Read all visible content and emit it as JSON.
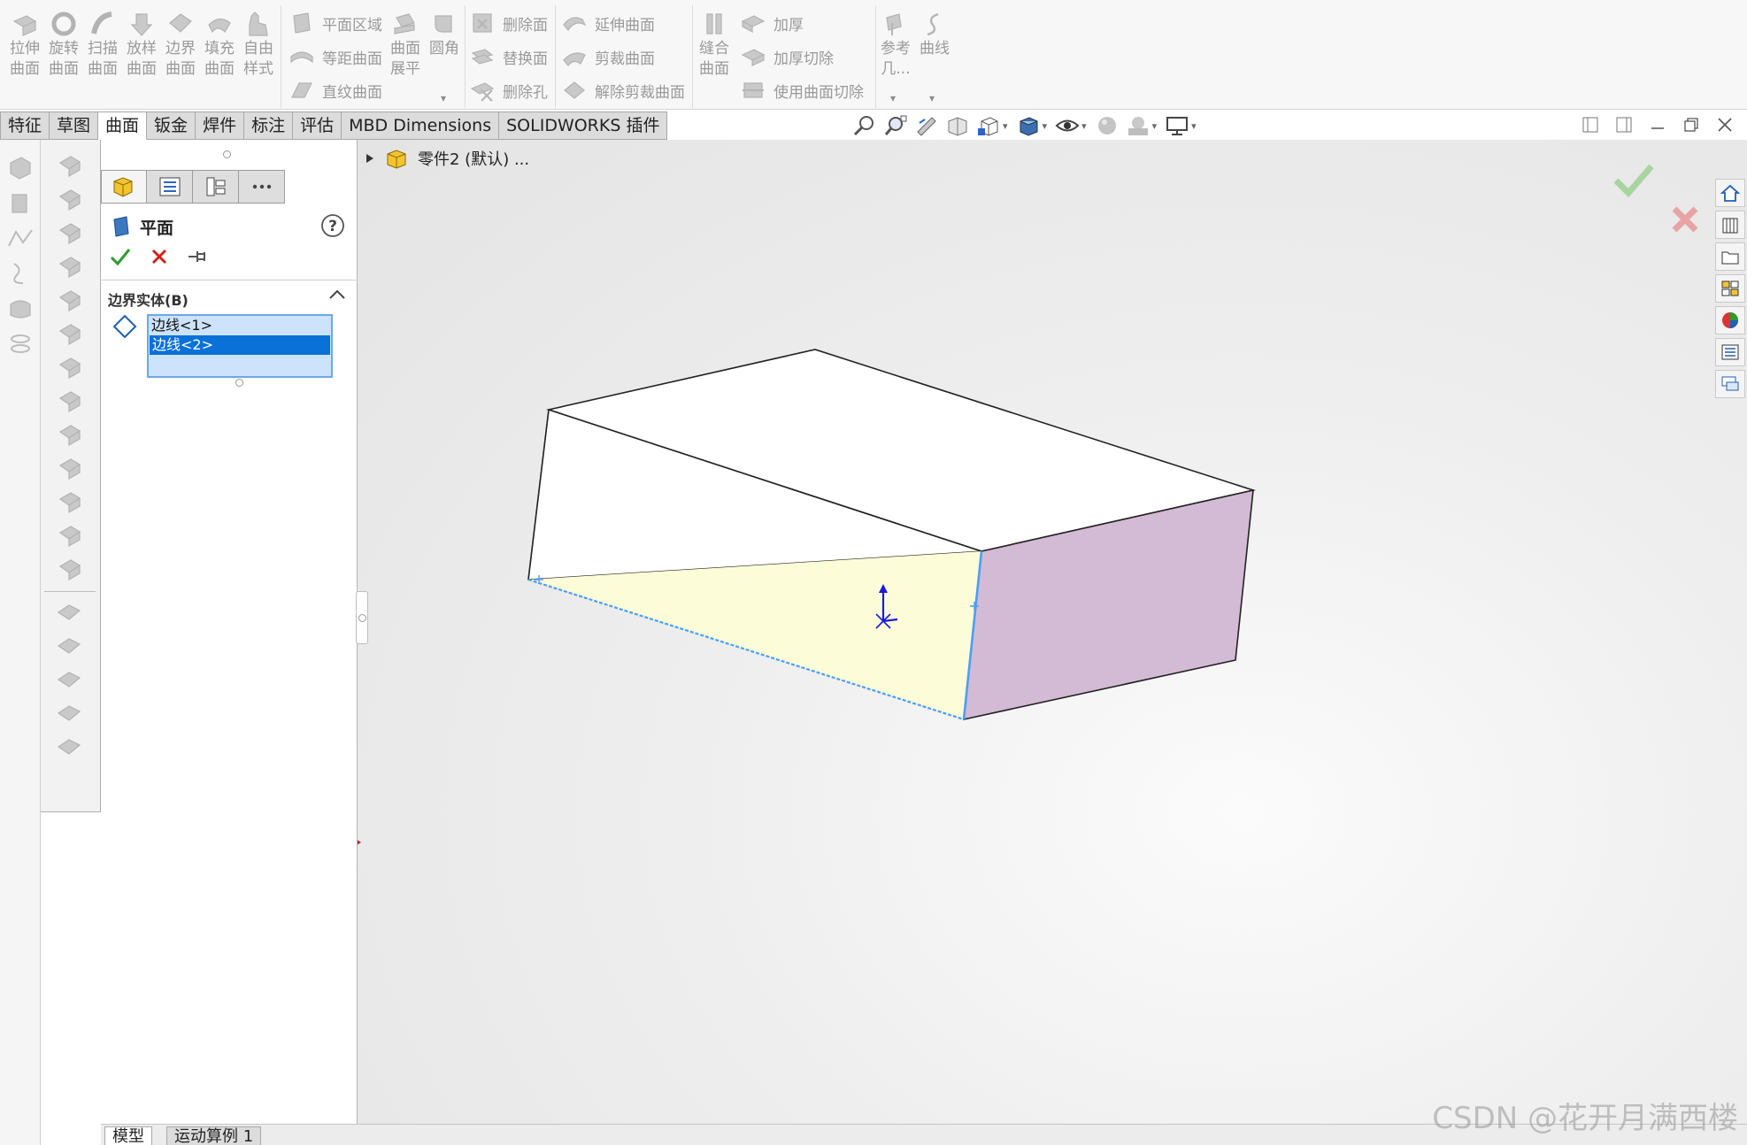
{
  "ribbon": {
    "big_tools": [
      {
        "l1": "拉伸",
        "l2": "曲面",
        "icon": "extrude-surface-icon"
      },
      {
        "l1": "旋转",
        "l2": "曲面",
        "icon": "revolve-surface-icon"
      },
      {
        "l1": "扫描",
        "l2": "曲面",
        "icon": "sweep-surface-icon"
      },
      {
        "l1": "放样",
        "l2": "曲面",
        "icon": "loft-surface-icon"
      },
      {
        "l1": "边界",
        "l2": "曲面",
        "icon": "boundary-surface-icon"
      },
      {
        "l1": "填充",
        "l2": "曲面",
        "icon": "fill-surface-icon"
      },
      {
        "l1": "自由",
        "l2": "样式",
        "icon": "freeform-icon"
      }
    ],
    "group2_rows": [
      "平面区域",
      "等距曲面",
      "直纹曲面"
    ],
    "flatten": {
      "l1": "曲面",
      "l2": "展平"
    },
    "fillet": {
      "l1": "圆角",
      "l2": ""
    },
    "group3_rows": [
      "删除面",
      "替换面",
      "删除孔"
    ],
    "group4_rows": [
      "延伸曲面",
      "剪裁曲面",
      "解除剪裁曲面"
    ],
    "knit": {
      "l1": "缝合",
      "l2": "曲面"
    },
    "group5_rows": [
      "加厚",
      "加厚切除",
      "使用曲面切除"
    ],
    "ref_geom": {
      "l1": "参考",
      "l2": "几..."
    },
    "curves": {
      "l1": "曲线",
      "l2": ""
    }
  },
  "tabs": [
    "特征",
    "草图",
    "曲面",
    "钣金",
    "焊件",
    "标注",
    "评估",
    "MBD Dimensions",
    "SOLIDWORKS 插件"
  ],
  "active_tab": "曲面",
  "property_manager": {
    "title": "平面",
    "section_title": "边界实体(B)",
    "selections": [
      "边线<1>",
      "边线<2>"
    ],
    "selected_index": 1
  },
  "viewport": {
    "tree_item": "零件2 (默认) ...",
    "colors": {
      "top_face": "#ffffff",
      "front_face": "#fcfcd8",
      "side_face": "#d3bad5",
      "selected_edge": "#4a9ff5"
    }
  },
  "bottom_tabs": [
    "模型",
    "运动算例 1"
  ],
  "watermark": "CSDN @花开月满西楼"
}
